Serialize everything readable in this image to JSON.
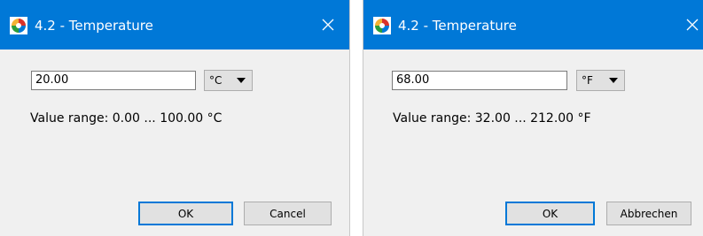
{
  "colors": {
    "titlebar": "#0078d7",
    "dialog_bg": "#f0f0f0",
    "accent_border": "#0078d7"
  },
  "dialogs": [
    {
      "title": "4.2 - Temperature",
      "title_icon": "app-logo-icon",
      "close_icon": "close-icon",
      "value": "20.00",
      "unit": "°C",
      "range": "Value range: 0.00 ... 100.00 °C",
      "ok_label": "OK",
      "cancel_label": "Cancel"
    },
    {
      "title": "4.2 - Temperature",
      "title_icon": "app-logo-icon",
      "close_icon": "close-icon",
      "value": "68.00",
      "unit": "°F",
      "range": "Value range: 32.00 ... 212.00 °F",
      "ok_label": "OK",
      "cancel_label": "Abbrechen"
    }
  ]
}
